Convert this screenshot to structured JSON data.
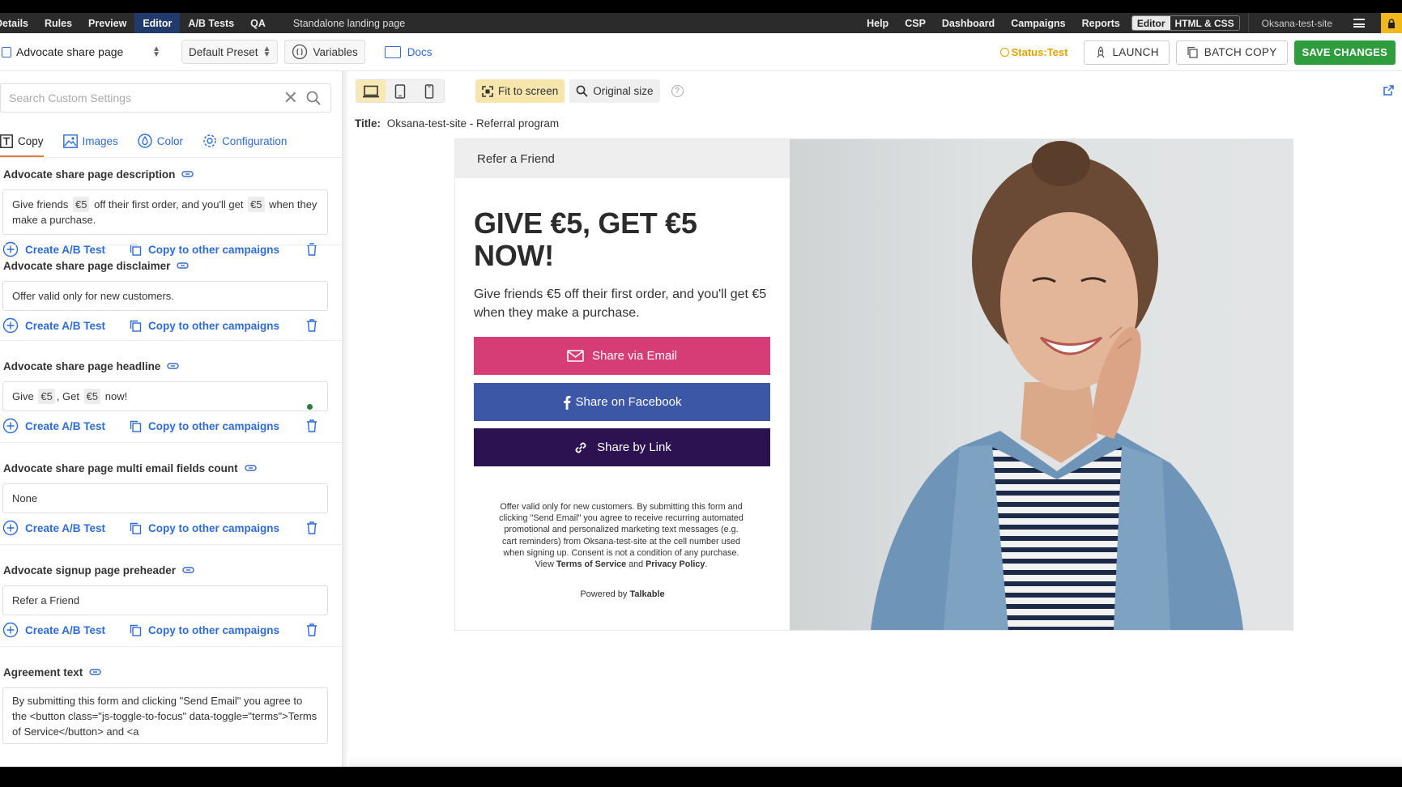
{
  "topnav": {
    "left_items": [
      "Details",
      "Rules",
      "Preview",
      "Editor",
      "A/B Tests",
      "QA"
    ],
    "active": "Editor",
    "page_label": "Standalone landing page",
    "right_items": [
      "Help",
      "CSP",
      "Dashboard",
      "Campaigns",
      "Reports"
    ],
    "mode_editor": "Editor",
    "mode_html": "HTML & CSS",
    "site": "Oksana-test-site"
  },
  "toolbar": {
    "page_select": "Advocate share page",
    "preset": "Default Preset",
    "variables": "Variables",
    "docs": "Docs",
    "status_label": "Status:",
    "status_value": "Test",
    "launch": "LAUNCH",
    "batch_copy": "BATCH COPY",
    "save": "SAVE CHANGES"
  },
  "left": {
    "search_placeholder": "Search Custom Settings",
    "tabs": [
      "Copy",
      "Images",
      "Color",
      "Configuration"
    ],
    "create_ab": "Create A/B Test",
    "copy_other": "Copy to other campaigns",
    "settings": {
      "s1_title": "Advocate share page description",
      "s1_a": "Give friends",
      "s1_chip1": "€5",
      "s1_b": "off their first order, and you'll get",
      "s1_chip2": "€5",
      "s1_c": "when they make a purchase.",
      "s2_title": "Advocate share page disclaimer",
      "s2_value": "Offer valid only for new customers.",
      "s3_title": "Advocate share page headline",
      "s3_a": "Give",
      "s3_chip1": "€5",
      "s3_b": ", Get",
      "s3_chip2": "€5",
      "s3_c": "now!",
      "s4_title": "Advocate share page multi email fields count",
      "s4_value": "None",
      "s5_title": "Advocate signup page preheader",
      "s5_value": "Refer a Friend",
      "s6_title": "Agreement text",
      "s6_value": "By submitting this form and clicking \"Send Email\" you agree to the <button class=\"js-toggle-to-focus\" data-toggle=\"terms\">Terms of Service</button> and <a"
    }
  },
  "preview": {
    "fit": "Fit to screen",
    "original": "Original size",
    "help": "?",
    "title_label": "Title:",
    "title_value": "Oksana-test-site - Referral program"
  },
  "landing": {
    "preheader": "Refer a Friend",
    "headline": "GIVE €5, GET €5 NOW!",
    "description": "Give friends €5 off their first order, and you'll get €5 when they make a purchase.",
    "btn_email": "Share via Email",
    "btn_facebook": "Share on Facebook",
    "btn_link": "Share by Link",
    "disclaimer": "Offer valid only for new customers. By submitting this form and clicking \"Send Email\" you agree to receive recurring automated promotional and personalized marketing text messages (e.g. cart reminders) from Oksana-test-site at the cell number used when signing up. Consent is not a condition of any purchase.",
    "view_prefix": "View",
    "terms": "Terms of Service",
    "and": "and",
    "privacy": "Privacy Policy",
    "period": ".",
    "powered_prefix": "Powered by",
    "powered_brand": "Talkable"
  },
  "colors": {
    "save": "#2f9c3e",
    "email": "#d63c76",
    "facebook": "#3b57a6",
    "link": "#2c1250",
    "accent_link": "#2d6bd6",
    "status": "#e0a300"
  }
}
